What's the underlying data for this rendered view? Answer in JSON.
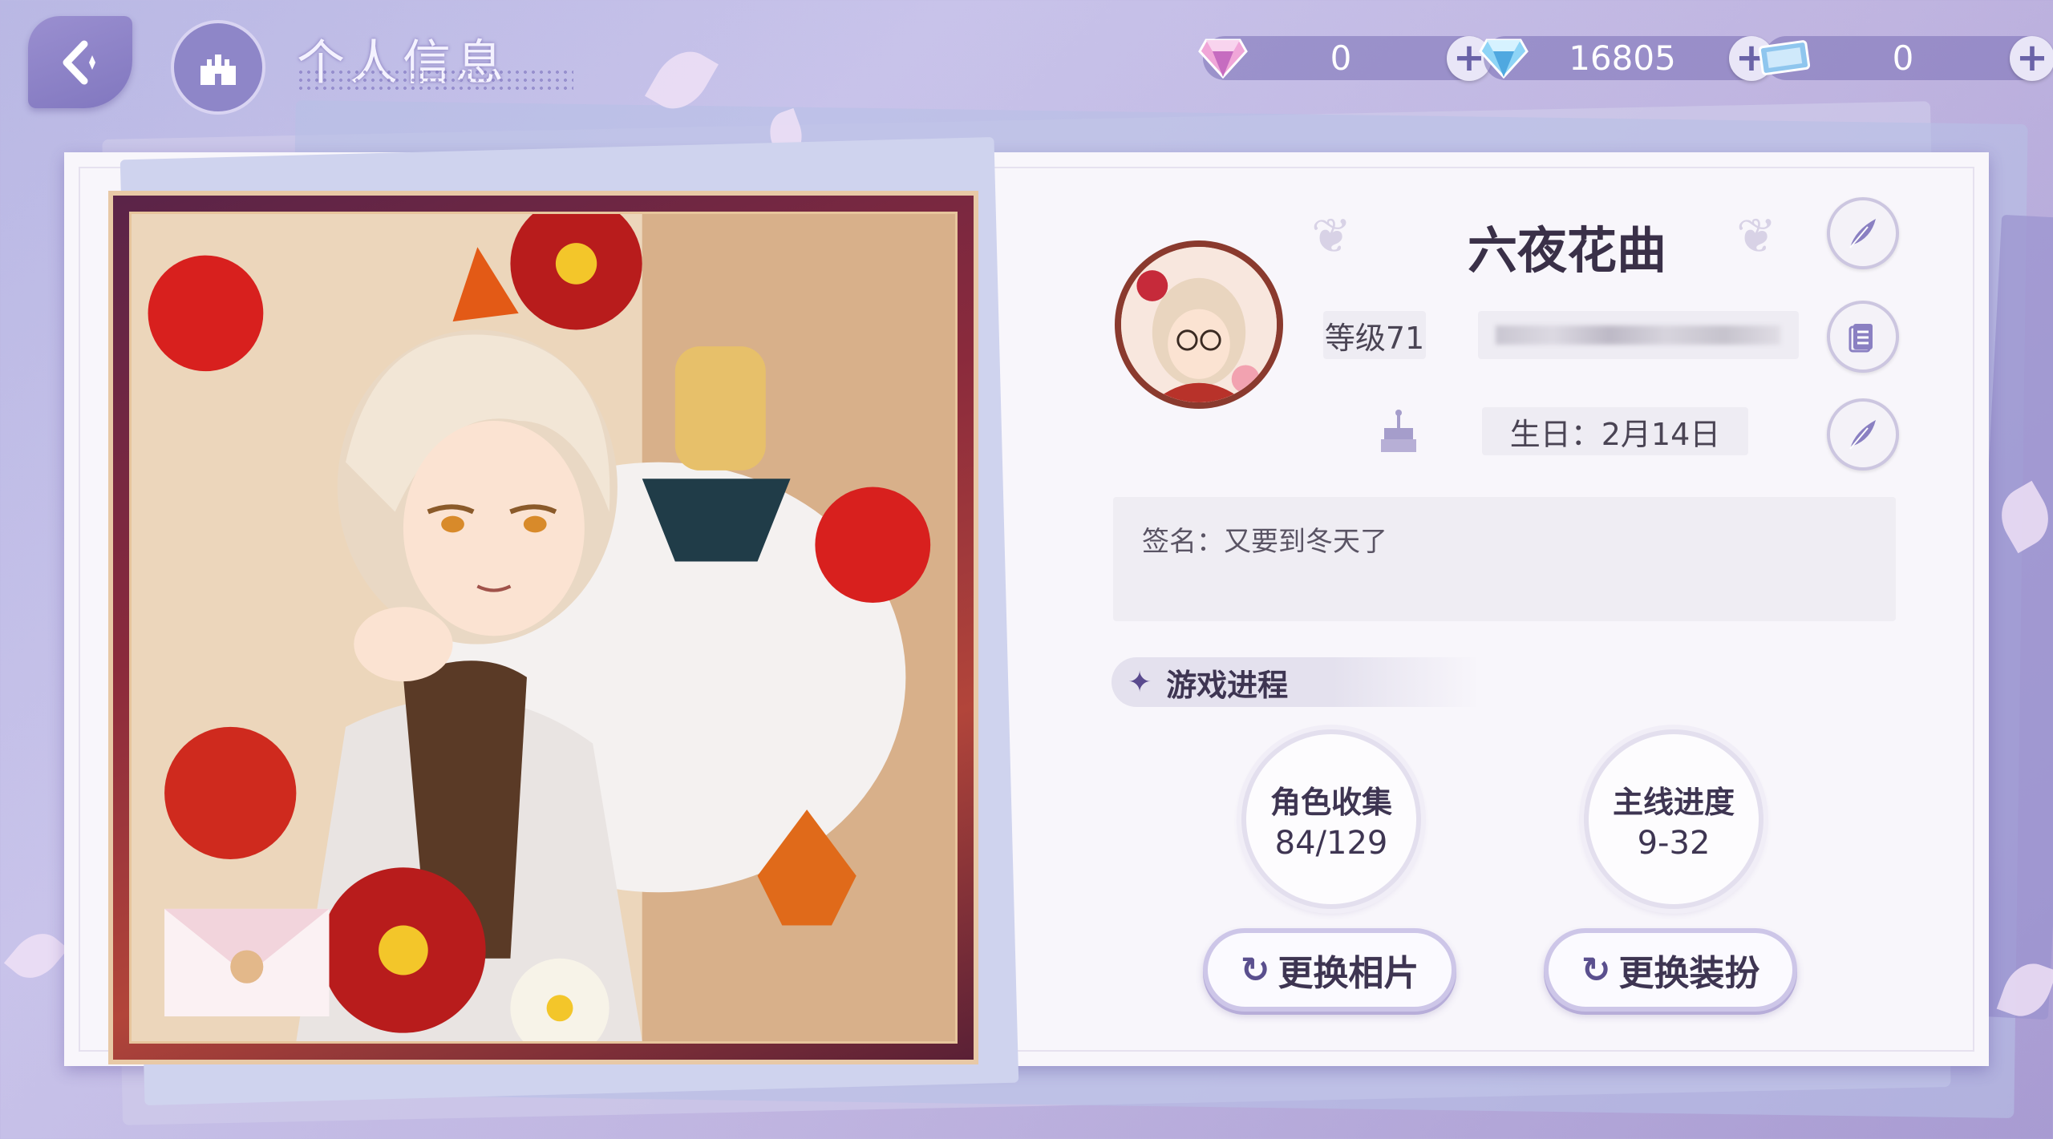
{
  "header": {
    "title": "个人信息"
  },
  "currencies": [
    {
      "icon": "pink-gem-icon",
      "value": "0"
    },
    {
      "icon": "blue-diamond-icon",
      "value": "16805"
    },
    {
      "icon": "ticket-icon",
      "value": "0"
    }
  ],
  "profile": {
    "name": "六夜花曲",
    "level": "等级71",
    "birthday": "生日：2月14日",
    "signature": "签名：又要到冬天了"
  },
  "progress": {
    "heading": "游戏进程",
    "character_collection": {
      "label": "角色收集",
      "value": "84/129"
    },
    "main_story": {
      "label": "主线进度",
      "value": "9-32"
    }
  },
  "actions": {
    "change_photo": "更换相片",
    "change_outfit": "更换装扮"
  },
  "colors": {
    "accent": "#8177bf",
    "panel": "#f8f6fb",
    "text": "#3e3552"
  }
}
